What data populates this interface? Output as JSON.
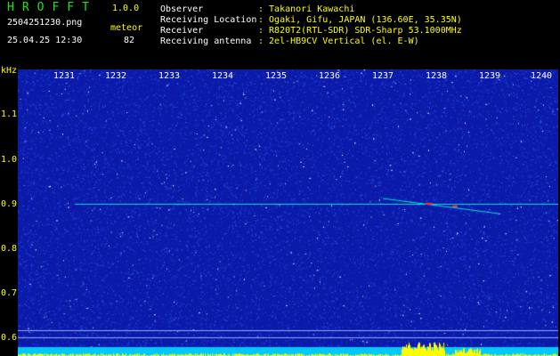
{
  "header": {
    "app_title": "HROFFT",
    "version": "1.0.0",
    "filename": "2504251230.png",
    "datetime": "25.04.25 12:30",
    "meteor_label": "meteor",
    "meteor_count": "82",
    "fields": [
      {
        "label": "Observer",
        "value": ": Takanori Kawachi"
      },
      {
        "label": "Receiving Location",
        "value": ": Ogaki, Gifu, JAPAN (136.60E, 35.35N)"
      },
      {
        "label": "Receiver",
        "value": ": R820T2(RTL-SDR) SDR-Sharp 53.1000MHz"
      },
      {
        "label": "Receiving antenna",
        "value": ": 2el-HB9CV Vertical (el. E-W)"
      }
    ]
  },
  "spectrogram": {
    "y_unit": "kHz",
    "y_ticks": [
      "1.1",
      "1.0",
      "0.9",
      "0.8",
      "0.7",
      "0.6"
    ],
    "x_ticks": [
      "1231",
      "1232",
      "1233",
      "1234",
      "1235",
      "1236",
      "1237",
      "1238",
      "1239",
      "1240"
    ],
    "colors": {
      "background": "#0b1aa8",
      "noise_low": "#1a3fe0",
      "noise_high": "#ffffff",
      "signal": "#00e0d0",
      "meteor_hot": "#ff3030",
      "bottom_bar": "#00c8ff",
      "peak": "#ffff00"
    }
  }
}
